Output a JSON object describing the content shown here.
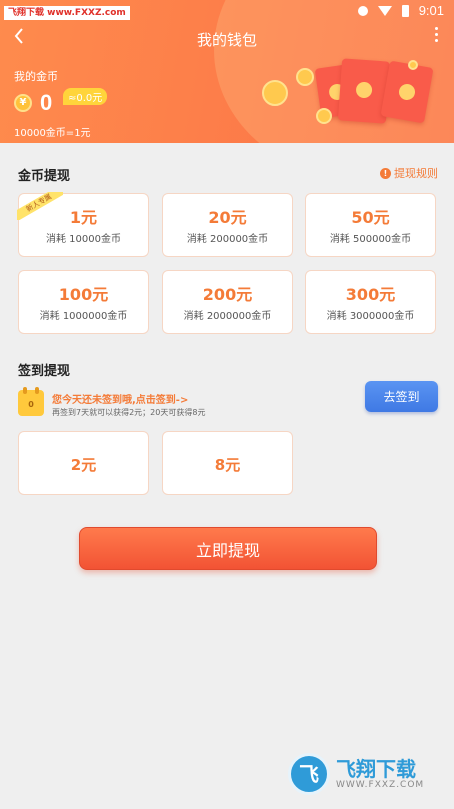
{
  "status_bar": {
    "watermark_text": "飞翔下载 www.FXXZ.com",
    "time": "9:01"
  },
  "header": {
    "title": "我的钱包",
    "coins_label": "我的金币",
    "coin_symbol": "¥",
    "coin_amount": "0",
    "coin_equiv": "≈0.0元",
    "exchange_rate": "10000金币=1元"
  },
  "coin_withdraw": {
    "title": "金币提现",
    "rules_link": "提现规则",
    "new_user_tag": "新人专属",
    "options": [
      {
        "amount": "1元",
        "cost": "消耗 10000金币"
      },
      {
        "amount": "20元",
        "cost": "消耗 200000金币"
      },
      {
        "amount": "50元",
        "cost": "消耗 500000金币"
      },
      {
        "amount": "100元",
        "cost": "消耗 1000000金币"
      },
      {
        "amount": "200元",
        "cost": "消耗 2000000金币"
      },
      {
        "amount": "300元",
        "cost": "消耗 3000000金币"
      }
    ]
  },
  "signin_withdraw": {
    "title": "签到提现",
    "calendar_count": "0",
    "main_text": "您今天还未签到哦,点击签到->",
    "sub_text": "再签到7天就可以获得2元；20天可获得8元",
    "button_label": "去签到",
    "options": [
      {
        "amount": "2元"
      },
      {
        "amount": "8元"
      }
    ]
  },
  "withdraw_button": "立即提现",
  "footer_logo": {
    "mark": "飞",
    "name": "飞翔下载",
    "url": "WWW.FXXZ.COM"
  },
  "colors": {
    "header_orange": "#fd7f4a",
    "accent_orange": "#f47b38",
    "signin_blue": "#3f79e4",
    "withdraw_red": "#f25334"
  }
}
